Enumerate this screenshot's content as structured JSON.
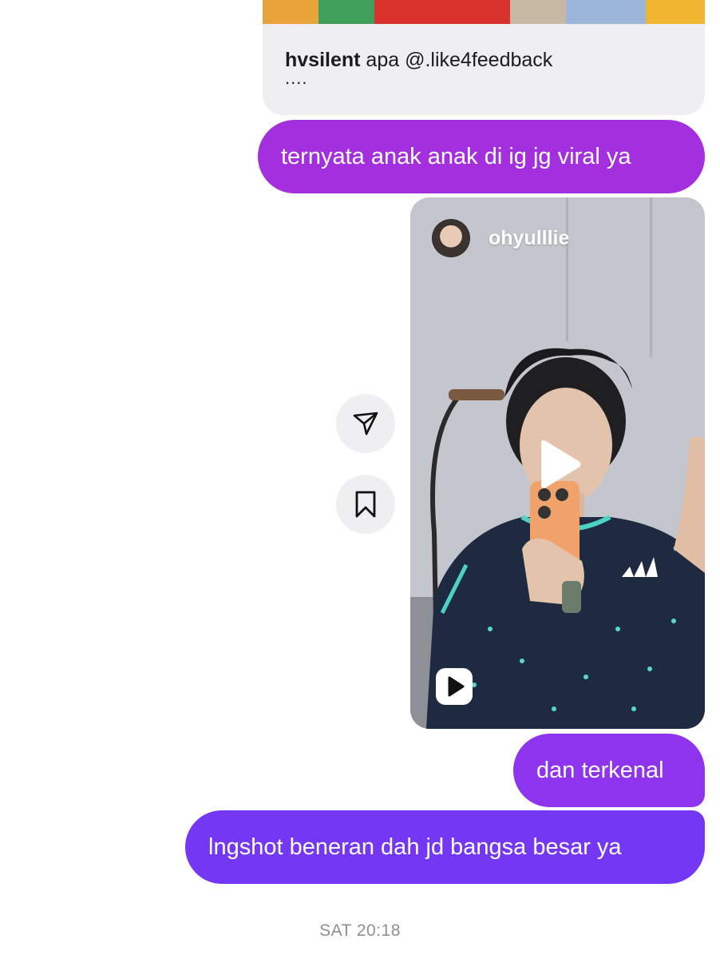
{
  "shared_post": {
    "username": "hvsilent",
    "caption": " apa @.like4feedback",
    "more": "....",
    "strip_colors": [
      "#e8a43a",
      "#3f9f5b",
      "#d9322c",
      "#c7b8a4",
      "#9bb6d8",
      "#f0b632"
    ]
  },
  "messages": [
    {
      "text": "ternyata anak anak di ig jg viral ya",
      "color": "#a42fdf"
    },
    {
      "text": "dan terkenal",
      "color": "#8e34ee"
    },
    {
      "text": "lngshot beneran dah jd bangsa besar ya",
      "color": "#7437f3"
    }
  ],
  "reel": {
    "username": "ohyulllie",
    "icons": [
      "play-icon",
      "reels-icon"
    ]
  },
  "actions": {
    "share_icon": "send-icon",
    "save_icon": "bookmark-icon"
  },
  "timestamp": "SAT 20:18"
}
